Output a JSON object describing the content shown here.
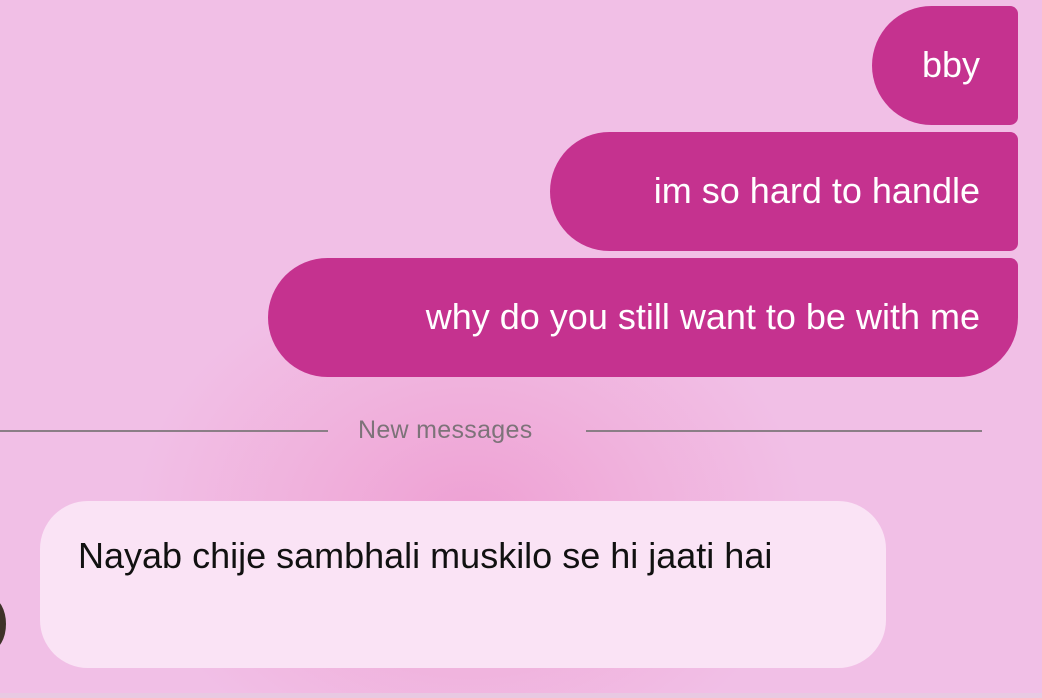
{
  "colors": {
    "background": "#f1bfe6",
    "sent_bubble": "#c5328f",
    "received_bubble": "#fae3f5",
    "divider": "#8a7e86"
  },
  "messages": {
    "sent": [
      {
        "text": "bby"
      },
      {
        "text": "im so hard to handle"
      },
      {
        "text": "why do you still want to be with me"
      }
    ],
    "received": [
      {
        "text": "Nayab chije sambhali muskilo se hi jaati hai"
      }
    ]
  },
  "divider": {
    "label": "New messages"
  }
}
